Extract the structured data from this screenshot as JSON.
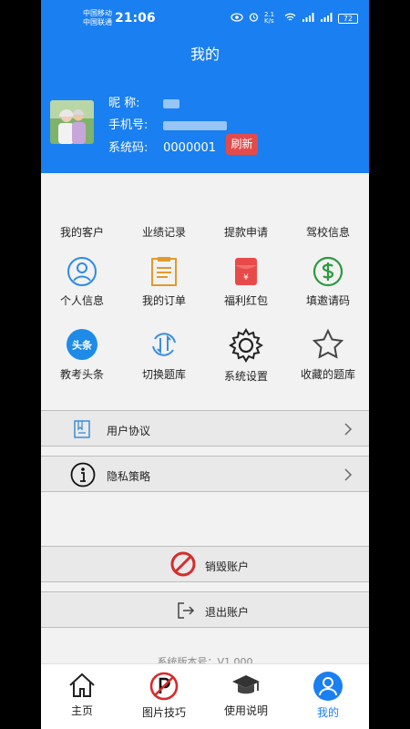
{
  "status": {
    "carrier_1": "中国移动",
    "carrier_2": "中国联通",
    "time": "21:06",
    "speed": "2.1 K/s",
    "battery": "72"
  },
  "header": {
    "title": "我的"
  },
  "profile": {
    "nickname_label": "昵  称:",
    "phone_label": "手机号:",
    "code_label": "系统码:",
    "code_value": "0000001",
    "refresh_label": "刷新"
  },
  "menu": {
    "row1": [
      "我的客户",
      "业绩记录",
      "提款申请",
      "驾校信息"
    ],
    "row2": [
      "个人信息",
      "我的订单",
      "福利红包",
      "填邀请码"
    ],
    "row3": [
      "教考头条",
      "切换题库",
      "系统设置",
      "收藏的题库"
    ],
    "toutiao_badge": "头条",
    "hongbao_symbol": "¥"
  },
  "list": {
    "agreement": "用户协议",
    "privacy": "隐私策略",
    "cancel_account": "销毁账户",
    "logout": "退出账户"
  },
  "version": "系统版本号：V1.000",
  "tabs": [
    {
      "label": "主页",
      "icon": "home-icon",
      "active": false
    },
    {
      "label": "图片技巧",
      "icon": "parking-icon",
      "active": false
    },
    {
      "label": "使用说明",
      "icon": "graduation-cap-icon",
      "active": false
    },
    {
      "label": "我的",
      "icon": "user-icon",
      "active": true
    }
  ],
  "colors": {
    "primary": "#1a7ff0",
    "refresh": "#e34b4b",
    "background": "#f2f2f2"
  }
}
